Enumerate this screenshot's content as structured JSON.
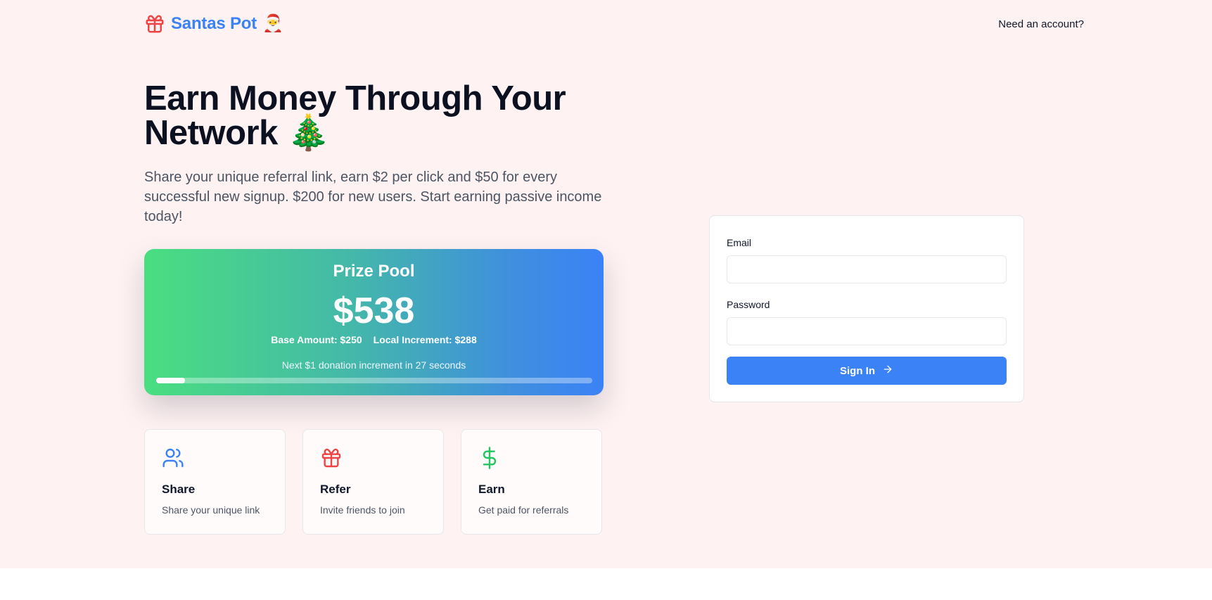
{
  "header": {
    "brand_name": "Santas Pot",
    "brand_emoji": "🎅",
    "brand_icon": "gift-icon",
    "need_account_link": "Need an account?"
  },
  "hero": {
    "title": "Earn Money Through Your Network",
    "title_emoji": "🎄",
    "subtitle": "Share your unique referral link, earn $2 per click and $50 for every successful new signup. $200 for new users. Start earning passive income today!"
  },
  "prize_pool": {
    "title": "Prize Pool",
    "amount": "$538",
    "base_amount": "Base Amount: $250",
    "local_increment": "Local Increment: $288",
    "next_increment": "Next $1 donation increment in 27 seconds",
    "progress_fraction": 0.066
  },
  "features": [
    {
      "icon": "users-icon",
      "title": "Share",
      "description": "Share your unique link",
      "color": "#3b82f6"
    },
    {
      "icon": "gift-icon",
      "title": "Refer",
      "description": "Invite friends to join",
      "color": "#ef4444"
    },
    {
      "icon": "dollar-icon",
      "title": "Earn",
      "description": "Get paid for referrals",
      "color": "#22c55e"
    }
  ],
  "login": {
    "email_label": "Email",
    "email_value": "",
    "password_label": "Password",
    "password_value": "",
    "sign_in_label": "Sign In",
    "sign_in_icon": "arrow-right-icon"
  },
  "colors": {
    "accent": "#3b82f6",
    "background": "#fef2f2",
    "gradient_start": "#4ade80",
    "gradient_end": "#3b82f6"
  }
}
